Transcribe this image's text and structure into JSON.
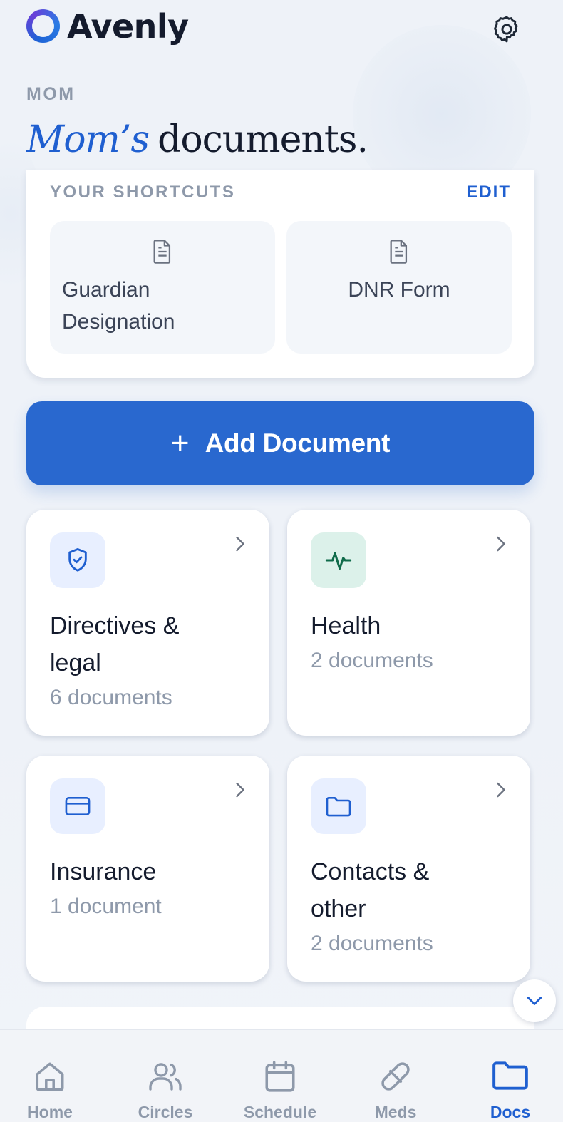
{
  "app": {
    "name": "Avenly"
  },
  "page": {
    "eyebrow": "MOM",
    "title_accent": "Mom’s",
    "title_rest": "documents."
  },
  "shortcuts": {
    "label": "YOUR SHORTCUTS",
    "edit_label": "EDIT",
    "items": [
      {
        "label_line1": "Guardian",
        "label_line2": "Designation",
        "icon": "document-icon"
      },
      {
        "label_line1": "DNR Form",
        "label_line2": "",
        "icon": "document-icon"
      }
    ]
  },
  "add_button": {
    "label": "Add Document",
    "icon": "plus-icon"
  },
  "categories": [
    {
      "title_line1": "Directives &",
      "title_line2": "legal",
      "count": "6 documents",
      "icon": "shield-check-icon",
      "icon_bg": "#e8efff",
      "icon_color": "#1f5fd0"
    },
    {
      "title_line1": "Health",
      "title_line2": "",
      "count": "2 documents",
      "icon": "pulse-icon",
      "icon_bg": "#dcf1ea",
      "icon_color": "#0f6b4a"
    },
    {
      "title_line1": "Insurance",
      "title_line2": "",
      "count": "1 document",
      "icon": "credit-card-icon",
      "icon_bg": "#e8efff",
      "icon_color": "#1f5fd0"
    },
    {
      "title_line1": "Contacts &",
      "title_line2": "other",
      "count": "2 documents",
      "icon": "folder-icon",
      "icon_bg": "#e8efff",
      "icon_color": "#1f5fd0"
    }
  ],
  "tabs": [
    {
      "label": "Home",
      "icon": "home-icon",
      "active": false
    },
    {
      "label": "Circles",
      "icon": "people-icon",
      "active": false
    },
    {
      "label": "Schedule",
      "icon": "calendar-icon",
      "active": false
    },
    {
      "label": "Meds",
      "icon": "pill-icon",
      "active": false
    },
    {
      "label": "Docs",
      "icon": "folder-icon",
      "active": true
    }
  ],
  "colors": {
    "primary": "#2968cf",
    "accent_text": "#1f5fd0",
    "muted": "#8e99aa",
    "ink": "#141b2d"
  }
}
